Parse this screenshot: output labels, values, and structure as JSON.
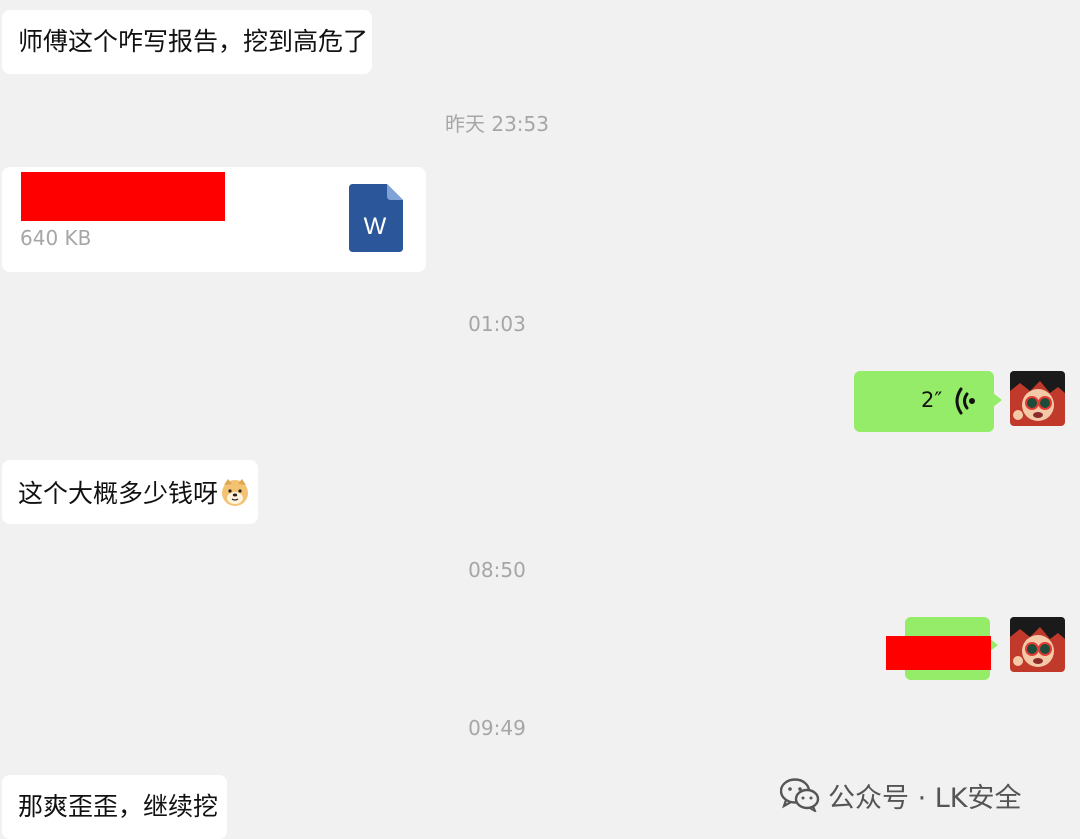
{
  "messages": {
    "m1": "师傅这个咋写报告，挖到高危了",
    "ts1": "昨天 23:53",
    "file": {
      "size": "640 KB",
      "icon": "word-doc-icon",
      "name_redacted_color": "#ff0000"
    },
    "ts2": "01:03",
    "voice": {
      "duration": "2″",
      "icon": "voice-wave-icon"
    },
    "m2": "这个大概多少钱呀",
    "m2_emoji": "doge-emoji-icon",
    "ts3": "08:50",
    "ts4": "09:49",
    "m3": "那爽歪歪，继续挖"
  },
  "watermark": {
    "text": "公众号 · LK安全",
    "icon": "wechat-icon"
  },
  "colors": {
    "background": "#f1f1f1",
    "bubble_self": "#95ec69",
    "bubble_other": "#ffffff",
    "timestamp": "#a6a6a6",
    "redaction": "#ff0000",
    "word_blue": "#2b579a"
  }
}
